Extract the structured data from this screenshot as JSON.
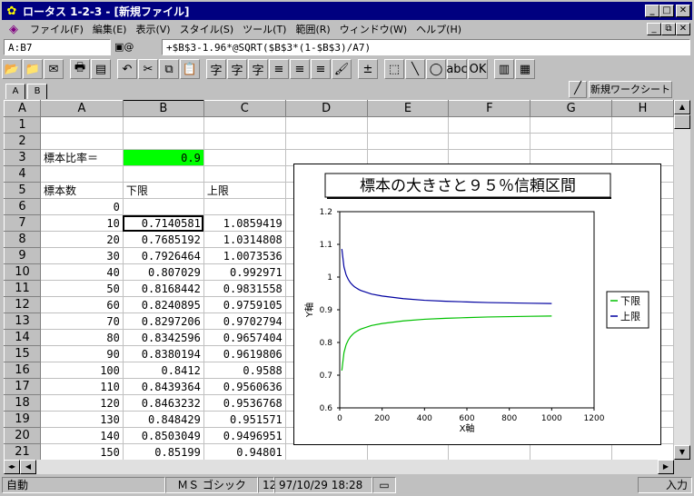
{
  "window": {
    "title": "ロータス 1-2-3 - [新規ファイル]",
    "min": "_",
    "max": "□",
    "close": "✕"
  },
  "menu": [
    "ファイル(F)",
    "編集(E)",
    "表示(V)",
    "スタイル(S)",
    "ツール(T)",
    "範囲(R)",
    "ウィンドウ(W)",
    "ヘルプ(H)"
  ],
  "formula_bar": {
    "cell_ref": "A:B7",
    "nav_icon": "▣@",
    "formula": "+$B$3-1.96*@SQRT($B$3*(1-$B$3)/A7)"
  },
  "toolbar_icons": [
    "open-folder-icon",
    "folder-icon",
    "envelope-icon",
    "print-icon",
    "print-preview-icon",
    "undo-icon",
    "cut-icon",
    "copy-icon",
    "paste-icon",
    "bold-icon",
    "italic-icon",
    "underline-icon",
    "align-left-icon",
    "align-center-icon",
    "align-right-icon",
    "style-brush-icon",
    "sum-icon",
    "select-icon",
    "line-icon",
    "ellipse-icon",
    "text-box-icon",
    "button-icon",
    "chart-icon",
    "window-icon"
  ],
  "toolbar_glyphs": [
    "📂",
    "📁",
    "✉",
    "🖶",
    "▤",
    "↶",
    "✂",
    "⧉",
    "📋",
    "字",
    "字",
    "字",
    "≡",
    "≡",
    "≡",
    "🖌",
    "±",
    "⬚",
    "╲",
    "◯",
    "abc",
    "OK",
    "▥",
    "▦"
  ],
  "tabs": [
    "A",
    "B"
  ],
  "new_sheet_label": "新規ワークシート",
  "columns": [
    "A",
    "B",
    "C",
    "D",
    "E",
    "F",
    "G",
    "H"
  ],
  "rows": [
    {
      "n": "1",
      "a": "",
      "b": "",
      "c": ""
    },
    {
      "n": "2",
      "a": "",
      "b": "",
      "c": ""
    },
    {
      "n": "3",
      "a": "標本比率＝",
      "b": "0.9",
      "c": ""
    },
    {
      "n": "4",
      "a": "",
      "b": "",
      "c": ""
    },
    {
      "n": "5",
      "a": "標本数",
      "b": "下限",
      "c": "上限"
    },
    {
      "n": "6",
      "a": "0",
      "b": "",
      "c": ""
    },
    {
      "n": "7",
      "a": "10",
      "b": "0.7140581",
      "c": "1.0859419"
    },
    {
      "n": "8",
      "a": "20",
      "b": "0.7685192",
      "c": "1.0314808"
    },
    {
      "n": "9",
      "a": "30",
      "b": "0.7926464",
      "c": "1.0073536"
    },
    {
      "n": "10",
      "a": "40",
      "b": "0.807029",
      "c": "0.992971"
    },
    {
      "n": "11",
      "a": "50",
      "b": "0.8168442",
      "c": "0.9831558"
    },
    {
      "n": "12",
      "a": "60",
      "b": "0.8240895",
      "c": "0.9759105"
    },
    {
      "n": "13",
      "a": "70",
      "b": "0.8297206",
      "c": "0.9702794"
    },
    {
      "n": "14",
      "a": "80",
      "b": "0.8342596",
      "c": "0.9657404"
    },
    {
      "n": "15",
      "a": "90",
      "b": "0.8380194",
      "c": "0.9619806"
    },
    {
      "n": "16",
      "a": "100",
      "b": "0.8412",
      "c": "0.9588"
    },
    {
      "n": "17",
      "a": "110",
      "b": "0.8439364",
      "c": "0.9560636"
    },
    {
      "n": "18",
      "a": "120",
      "b": "0.8463232",
      "c": "0.9536768"
    },
    {
      "n": "19",
      "a": "130",
      "b": "0.848429",
      "c": "0.951571"
    },
    {
      "n": "20",
      "a": "140",
      "b": "0.8503049",
      "c": "0.9496951"
    },
    {
      "n": "21",
      "a": "150",
      "b": "0.85199",
      "c": "0.94801"
    }
  ],
  "status": {
    "mode": "自動",
    "font": "ＭＳ ゴシック",
    "size": "12",
    "datetime": "97/10/29 18:28",
    "input": "入力"
  },
  "colors": {
    "title_bg": "#000080",
    "highlight": "#00ff00",
    "lower_series": "#00c000",
    "upper_series": "#0000a0"
  },
  "chart_data": {
    "type": "line",
    "title": "標本の大きさと９５％信頼区間",
    "xlabel": "X軸",
    "ylabel": "Y軸",
    "xlim": [
      0,
      1200
    ],
    "ylim": [
      0.6,
      1.2
    ],
    "xticks": [
      0,
      200,
      400,
      600,
      800,
      1000,
      1200
    ],
    "yticks": [
      0.6,
      0.7,
      0.8,
      0.9,
      1,
      1.1,
      1.2
    ],
    "ytick_labels": [
      "0.6",
      "0.7",
      "0.8",
      "0.9",
      "1",
      "1.1",
      "1.2"
    ],
    "legend_position": "right",
    "series": [
      {
        "name": "下限",
        "color": "#00c000",
        "x": [
          10,
          20,
          30,
          40,
          50,
          60,
          70,
          80,
          90,
          100,
          150,
          200,
          300,
          400,
          500,
          600,
          700,
          800,
          900,
          1000
        ],
        "y": [
          0.714,
          0.769,
          0.793,
          0.807,
          0.817,
          0.824,
          0.83,
          0.834,
          0.838,
          0.841,
          0.852,
          0.858,
          0.866,
          0.871,
          0.874,
          0.876,
          0.878,
          0.879,
          0.88,
          0.881
        ]
      },
      {
        "name": "上限",
        "color": "#0000a0",
        "x": [
          10,
          20,
          30,
          40,
          50,
          60,
          70,
          80,
          90,
          100,
          150,
          200,
          300,
          400,
          500,
          600,
          700,
          800,
          900,
          1000
        ],
        "y": [
          1.086,
          1.031,
          1.007,
          0.993,
          0.983,
          0.976,
          0.97,
          0.966,
          0.962,
          0.959,
          0.948,
          0.942,
          0.934,
          0.929,
          0.926,
          0.924,
          0.922,
          0.921,
          0.92,
          0.919
        ]
      }
    ]
  }
}
